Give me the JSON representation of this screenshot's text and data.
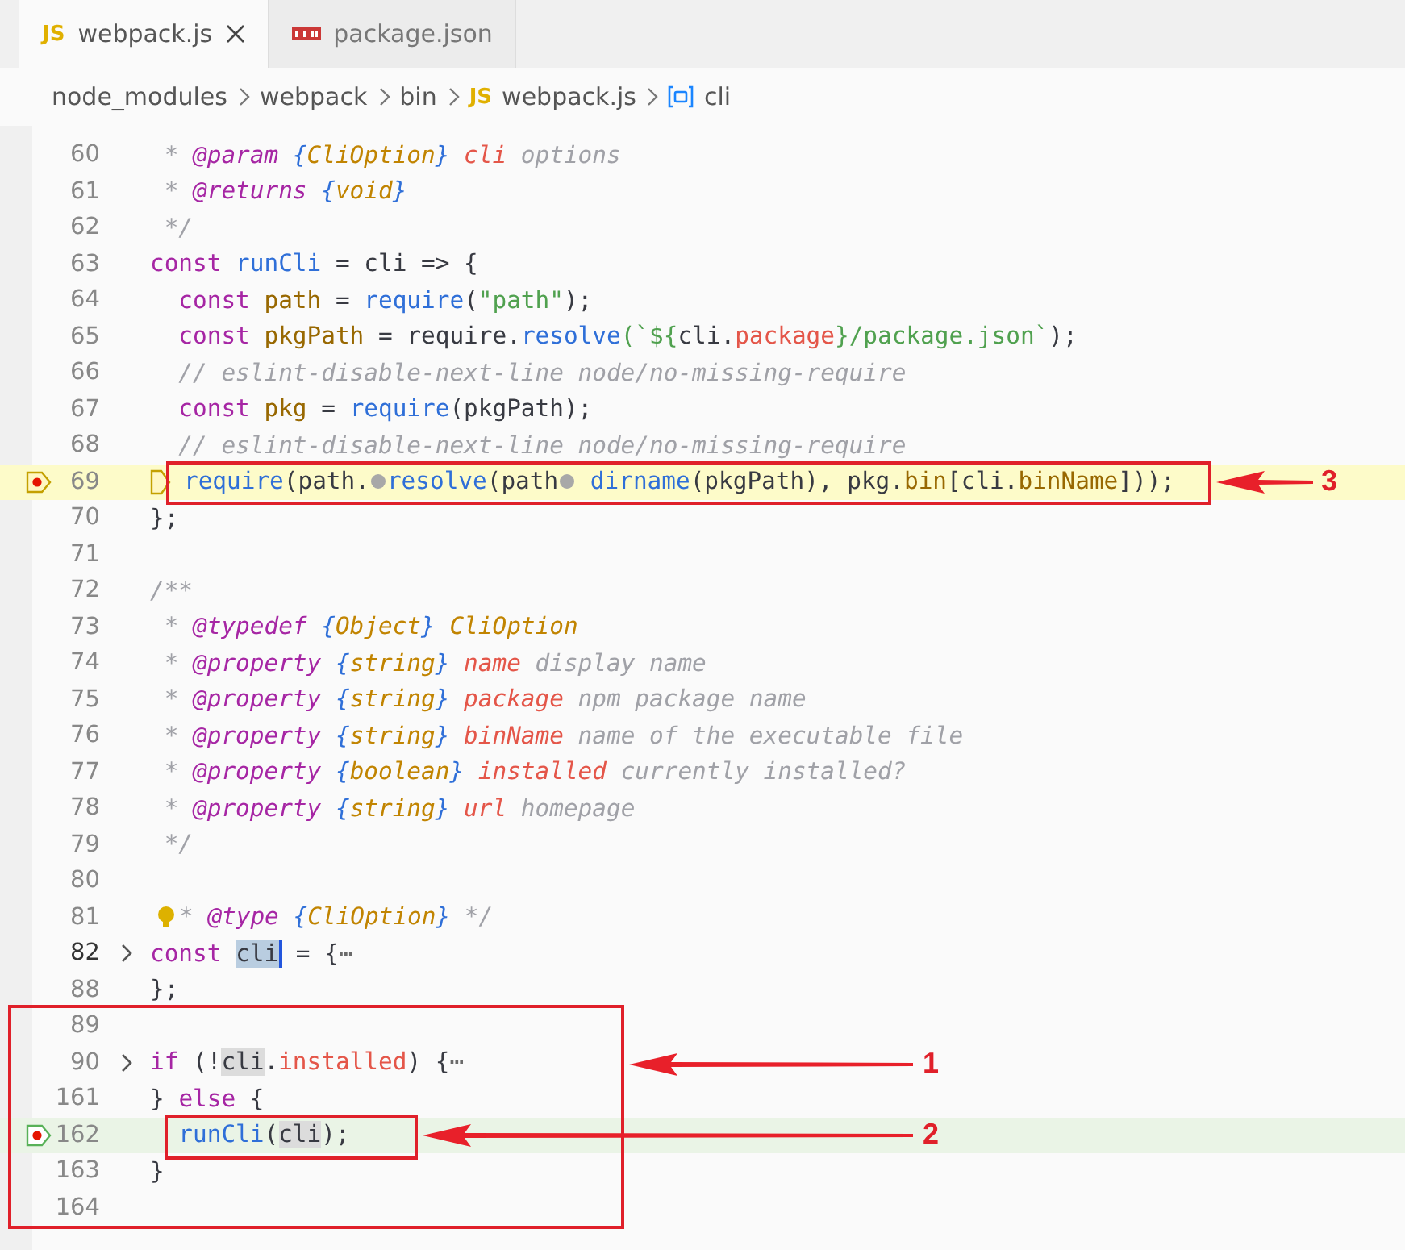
{
  "tabs": [
    {
      "kind": "js",
      "badge": "JS",
      "label": "webpack.js",
      "selected": true
    },
    {
      "kind": "npm",
      "label": "package.json",
      "selected": false
    }
  ],
  "breadcrumb": [
    {
      "kind": "folder",
      "label": "node_modules"
    },
    {
      "kind": "folder",
      "label": "webpack"
    },
    {
      "kind": "folder",
      "label": "bin"
    },
    {
      "kind": "js",
      "badge": "JS",
      "label": "webpack.js"
    },
    {
      "kind": "symbol",
      "label": "cli"
    }
  ],
  "lines": [
    {
      "number": "60",
      "tokens": [
        {
          "t": " * ",
          "kind": "cmt"
        },
        {
          "t": "@param",
          "kind": "tag"
        },
        {
          "t": " {",
          "kind": "brace"
        },
        {
          "t": "CliOption",
          "kind": "type"
        },
        {
          "t": "}",
          "kind": "brace"
        },
        {
          "t": " cli",
          "kind": "param"
        },
        {
          "t": " options",
          "kind": "cmt"
        }
      ]
    },
    {
      "number": "61",
      "tokens": [
        {
          "t": " * ",
          "kind": "cmt"
        },
        {
          "t": "@returns",
          "kind": "tag"
        },
        {
          "t": " {",
          "kind": "brace"
        },
        {
          "t": "void",
          "kind": "type"
        },
        {
          "t": "}",
          "kind": "brace"
        }
      ]
    },
    {
      "number": "62",
      "tokens": [
        {
          "t": " */",
          "kind": "cmt"
        }
      ]
    },
    {
      "number": "63",
      "tokens": [
        {
          "t": "const",
          "kind": "kw"
        },
        {
          "t": " runCli",
          "kind": "fn"
        },
        {
          "t": " = cli => {",
          "kind": "plain"
        }
      ]
    },
    {
      "number": "64",
      "tokens": [
        {
          "t": "  const",
          "kind": "kw"
        },
        {
          "t": " path",
          "kind": "var"
        },
        {
          "t": " = ",
          "kind": "plain"
        },
        {
          "t": "require",
          "kind": "fn"
        },
        {
          "t": "(",
          "kind": "plain"
        },
        {
          "t": "\"path\"",
          "kind": "str"
        },
        {
          "t": ");",
          "kind": "plain"
        }
      ]
    },
    {
      "number": "65",
      "tokens": [
        {
          "t": "  const",
          "kind": "kw"
        },
        {
          "t": " pkgPath",
          "kind": "var"
        },
        {
          "t": " = require.",
          "kind": "plain"
        },
        {
          "t": "resolve",
          "kind": "fn"
        },
        {
          "t": "(`${",
          "kind": "str"
        },
        {
          "t": "cli.",
          "kind": "plain"
        },
        {
          "t": "package",
          "kind": "param"
        },
        {
          "t": "}/package.json`",
          "kind": "str"
        },
        {
          "t": ");",
          "kind": "plain"
        }
      ]
    },
    {
      "number": "66",
      "tokens": [
        {
          "t": "  // eslint-disable-next-line node/no-missing-require",
          "kind": "cmt"
        }
      ]
    },
    {
      "number": "67",
      "tokens": [
        {
          "t": "  const",
          "kind": "kw"
        },
        {
          "t": " pkg",
          "kind": "var"
        },
        {
          "t": " = ",
          "kind": "plain"
        },
        {
          "t": "require",
          "kind": "fn"
        },
        {
          "t": "(pkgPath);",
          "kind": "plain"
        }
      ]
    },
    {
      "number": "68",
      "tokens": [
        {
          "t": "  // eslint-disable-next-line node/no-missing-require",
          "kind": "cmt"
        }
      ]
    },
    {
      "number": "69",
      "kind": "current_frame",
      "tokens": [
        {
          "t": "require",
          "kind": "fn"
        },
        {
          "t": "(path.",
          "kind": "plain"
        },
        {
          "kind": "breakpoint"
        },
        {
          "t": "resolve",
          "kind": "fn"
        },
        {
          "t": "(path",
          "kind": "plain"
        },
        {
          "kind": "breakpoint"
        },
        {
          "t": " dirname",
          "kind": "fn"
        },
        {
          "t": "(pkgPath), pkg.",
          "kind": "plain"
        },
        {
          "t": "bin",
          "kind": "var"
        },
        {
          "t": "[cli.",
          "kind": "plain"
        },
        {
          "t": "binName",
          "kind": "var"
        },
        {
          "t": "]));",
          "kind": "plain"
        }
      ]
    },
    {
      "number": "70",
      "tokens": [
        {
          "t": "};",
          "kind": "plain"
        }
      ]
    },
    {
      "number": "71"
    },
    {
      "number": "72",
      "tokens": [
        {
          "t": "/**",
          "kind": "cmt"
        }
      ]
    },
    {
      "number": "73",
      "tokens": [
        {
          "t": " * ",
          "kind": "cmt"
        },
        {
          "t": "@typedef",
          "kind": "tag"
        },
        {
          "t": " {",
          "kind": "brace"
        },
        {
          "t": "Object",
          "kind": "type"
        },
        {
          "t": "}",
          "kind": "brace"
        },
        {
          "t": " CliOption",
          "kind": "type"
        }
      ]
    },
    {
      "number": "74",
      "tokens": [
        {
          "t": " * ",
          "kind": "cmt"
        },
        {
          "t": "@property",
          "kind": "tag"
        },
        {
          "t": " {",
          "kind": "brace"
        },
        {
          "t": "string",
          "kind": "type"
        },
        {
          "t": "}",
          "kind": "brace"
        },
        {
          "t": " name",
          "kind": "param"
        },
        {
          "t": " display name",
          "kind": "cmt"
        }
      ]
    },
    {
      "number": "75",
      "tokens": [
        {
          "t": " * ",
          "kind": "cmt"
        },
        {
          "t": "@property",
          "kind": "tag"
        },
        {
          "t": " {",
          "kind": "brace"
        },
        {
          "t": "string",
          "kind": "type"
        },
        {
          "t": "}",
          "kind": "brace"
        },
        {
          "t": " package",
          "kind": "param"
        },
        {
          "t": " npm package name",
          "kind": "cmt"
        }
      ]
    },
    {
      "number": "76",
      "tokens": [
        {
          "t": " * ",
          "kind": "cmt"
        },
        {
          "t": "@property",
          "kind": "tag"
        },
        {
          "t": " {",
          "kind": "brace"
        },
        {
          "t": "string",
          "kind": "type"
        },
        {
          "t": "}",
          "kind": "brace"
        },
        {
          "t": " binName",
          "kind": "param"
        },
        {
          "t": " name of the executable file",
          "kind": "cmt"
        }
      ]
    },
    {
      "number": "77",
      "tokens": [
        {
          "t": " * ",
          "kind": "cmt"
        },
        {
          "t": "@property",
          "kind": "tag"
        },
        {
          "t": " {",
          "kind": "brace"
        },
        {
          "t": "boolean",
          "kind": "type"
        },
        {
          "t": "}",
          "kind": "brace"
        },
        {
          "t": " installed",
          "kind": "param"
        },
        {
          "t": " currently installed?",
          "kind": "cmt"
        }
      ]
    },
    {
      "number": "78",
      "tokens": [
        {
          "t": " * ",
          "kind": "cmt"
        },
        {
          "t": "@property",
          "kind": "tag"
        },
        {
          "t": " {",
          "kind": "brace"
        },
        {
          "t": "string",
          "kind": "type"
        },
        {
          "t": "}",
          "kind": "brace"
        },
        {
          "t": " url",
          "kind": "param"
        },
        {
          "t": " homepage",
          "kind": "cmt"
        }
      ]
    },
    {
      "number": "79",
      "tokens": [
        {
          "t": " */",
          "kind": "cmt"
        }
      ]
    },
    {
      "number": "80"
    },
    {
      "number": "81",
      "lightbulb": true,
      "tokens": [
        {
          "t": "* ",
          "kind": "cmt"
        },
        {
          "t": "@type",
          "kind": "tag"
        },
        {
          "t": " {",
          "kind": "brace"
        },
        {
          "t": "CliOption",
          "kind": "type"
        },
        {
          "t": "}",
          "kind": "brace"
        },
        {
          "t": " */",
          "kind": "cmt"
        }
      ]
    },
    {
      "number": "82",
      "active": true,
      "folded": true,
      "tokens": [
        {
          "t": "const ",
          "kind": "kw"
        },
        {
          "t": "cli",
          "kind": "sel"
        },
        {
          "t": " = {",
          "kind": "plain"
        },
        {
          "t": "⋯",
          "kind": "fold"
        }
      ]
    },
    {
      "number": "88",
      "tokens": [
        {
          "t": "};",
          "kind": "plain"
        }
      ]
    },
    {
      "number": "89"
    },
    {
      "number": "90",
      "folded": true,
      "tokens": [
        {
          "t": "if",
          "kind": "kw"
        },
        {
          "t": " (!",
          "kind": "plain"
        },
        {
          "t": "cli",
          "kind": "word"
        },
        {
          "t": ".",
          "kind": "plain"
        },
        {
          "t": "installed",
          "kind": "param"
        },
        {
          "t": ") {",
          "kind": "plain"
        },
        {
          "t": "⋯",
          "kind": "fold"
        }
      ]
    },
    {
      "number": "161",
      "tokens": [
        {
          "t": "} ",
          "kind": "plain"
        },
        {
          "t": "else",
          "kind": "kw"
        },
        {
          "t": " {",
          "kind": "plain"
        }
      ]
    },
    {
      "number": "162",
      "kind": "stack_frame",
      "tokens": [
        {
          "t": "  runCli",
          "kind": "fn"
        },
        {
          "t": "(",
          "kind": "plain"
        },
        {
          "t": "cli",
          "kind": "word"
        },
        {
          "t": ");",
          "kind": "plain"
        }
      ]
    },
    {
      "number": "163",
      "tokens": [
        {
          "t": "}",
          "kind": "plain"
        }
      ]
    },
    {
      "number": "164"
    }
  ],
  "annotations": [
    {
      "label": "3"
    },
    {
      "label": "1"
    },
    {
      "label": "2"
    }
  ]
}
